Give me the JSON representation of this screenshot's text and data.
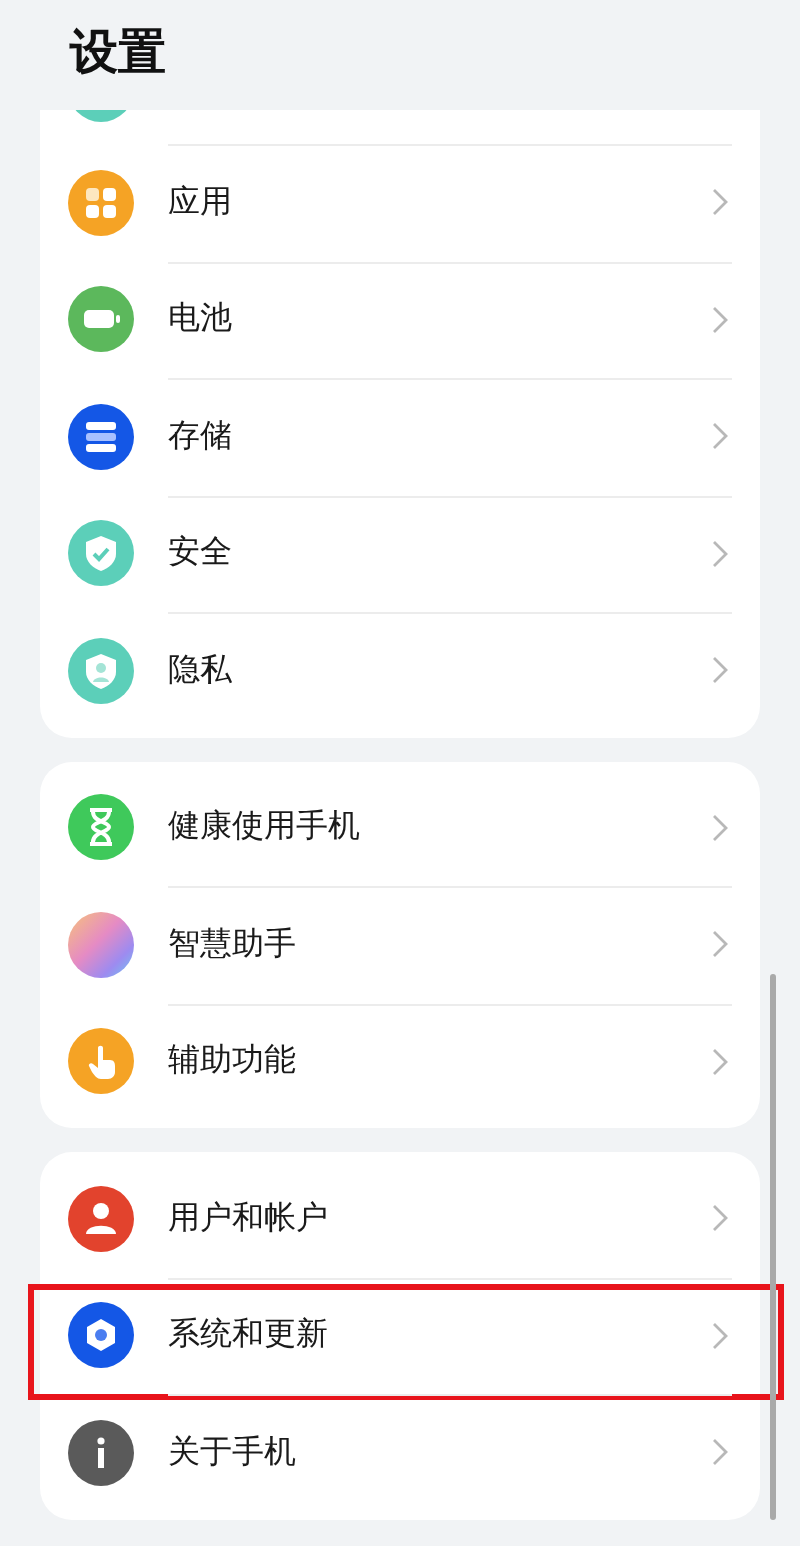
{
  "title": "设置",
  "groups": [
    {
      "partial_top": true,
      "items": [
        {
          "label": "应用",
          "highlighted": false
        },
        {
          "label": "电池",
          "highlighted": false
        },
        {
          "label": "存储",
          "highlighted": false
        },
        {
          "label": "安全",
          "highlighted": false
        },
        {
          "label": "隐私",
          "highlighted": false
        }
      ]
    },
    {
      "partial_top": false,
      "items": [
        {
          "label": "健康使用手机",
          "highlighted": false
        },
        {
          "label": "智慧助手",
          "highlighted": false
        },
        {
          "label": "辅助功能",
          "highlighted": false
        }
      ]
    },
    {
      "partial_top": false,
      "items": [
        {
          "label": "用户和帐户",
          "highlighted": false
        },
        {
          "label": "系统和更新",
          "highlighted": true
        },
        {
          "label": "关于手机",
          "highlighted": false
        }
      ]
    }
  ]
}
